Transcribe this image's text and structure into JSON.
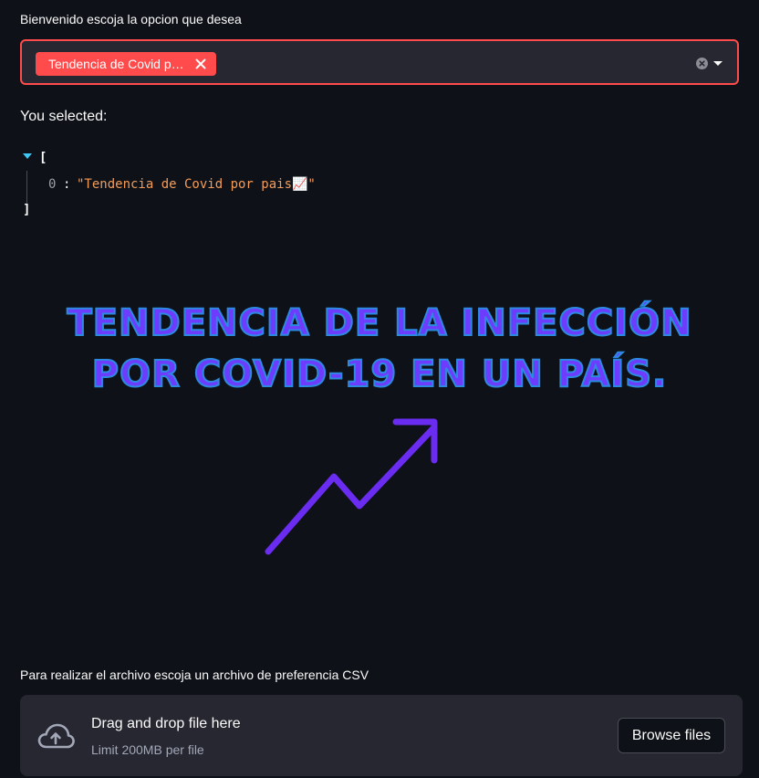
{
  "select": {
    "label": "Bienvenido escoja la opcion que desea",
    "tag_label": "Tendencia de Covid por pais📈"
  },
  "selection": {
    "heading": "You selected:",
    "json": {
      "open_bracket": "[",
      "index": "0",
      "colon": ":",
      "value": "\"Tendencia de Covid por pais📈\"",
      "close_bracket": "]"
    }
  },
  "banner": {
    "title": "TENDENCIA DE LA INFECCIÓN POR COVID-19 EN UN PAÍS.",
    "text_color": "#6d3cff",
    "outline_color": "#2b8ae0",
    "arrow_color": "#6a2cf0"
  },
  "uploader": {
    "label": "Para realizar el archivo escoja un archivo de preferencia CSV",
    "drop_title": "Drag and drop file here",
    "drop_limit": "Limit 200MB per file",
    "browse_label": "Browse files"
  },
  "colors": {
    "background": "#0e1117",
    "widget_bg": "#262730",
    "accent": "#ff4b4b",
    "json_string": "#f39c5a",
    "json_toggle": "#3ec8f5"
  },
  "icons": {
    "tag_close": "close-icon",
    "clear": "clear-icon",
    "caret": "chevron-down-icon",
    "toggle": "triangle-down-icon",
    "upload": "cloud-upload-icon",
    "trend": "trend-arrow-icon"
  }
}
